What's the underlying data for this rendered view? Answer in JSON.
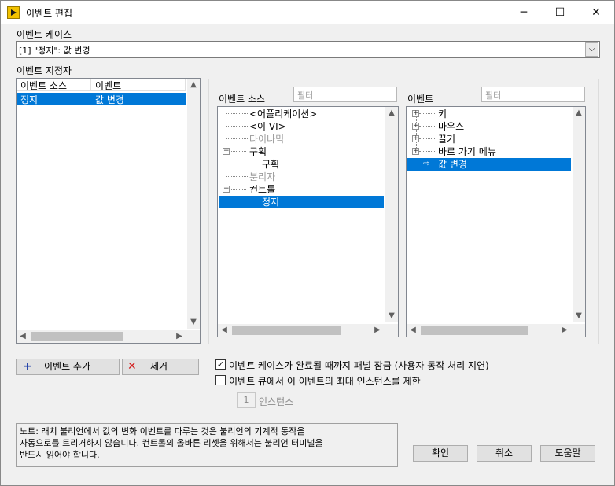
{
  "window": {
    "title": "이벤트 편집",
    "minimize_glyph": "─",
    "maximize_glyph": "☐",
    "close_glyph": "✕"
  },
  "event_cases": {
    "label": "이벤트 케이스",
    "selected": "[1] \"정지\": 값 변경",
    "dropdown_glyph": "⌵"
  },
  "specifiers": {
    "label": "이벤트 지정자",
    "columns": [
      "이벤트 소스",
      "이벤트"
    ],
    "rows": [
      {
        "source": "정지",
        "event": "값 변경"
      }
    ]
  },
  "event_sources": {
    "label": "이벤트 소스",
    "filter_placeholder": "필터",
    "items": [
      {
        "label": "<어플리케이션>",
        "disabled": false,
        "selected": false
      },
      {
        "label": "<이 VI>",
        "disabled": false,
        "selected": false
      },
      {
        "label": "다이나믹",
        "disabled": true,
        "selected": false
      },
      {
        "label": "구획",
        "disabled": false,
        "selected": false,
        "expander": "−"
      },
      {
        "label": "구획",
        "disabled": false,
        "selected": false
      },
      {
        "label": "분리자",
        "disabled": true,
        "selected": false
      },
      {
        "label": "컨트롤",
        "disabled": false,
        "selected": false,
        "expander": "−"
      },
      {
        "label": "정지",
        "disabled": false,
        "selected": true
      }
    ]
  },
  "events": {
    "label": "이벤트",
    "filter_placeholder": "필터",
    "items": [
      {
        "label": "키",
        "expander": "+",
        "selected": false
      },
      {
        "label": "마우스",
        "expander": "+",
        "selected": false
      },
      {
        "label": "끌기",
        "expander": "+",
        "selected": false
      },
      {
        "label": "바로 가기 메뉴",
        "expander": "+",
        "selected": false
      },
      {
        "label": "값 변경",
        "expander": "",
        "selected": true,
        "marker": "⇨"
      }
    ]
  },
  "buttons": {
    "add_event": "이벤트 추가",
    "add_icon": "+",
    "remove": "제거",
    "remove_icon": "✕",
    "ok": "확인",
    "cancel": "취소",
    "help": "도움말"
  },
  "options": {
    "lock_panel": {
      "label": "이벤트 케이스가 완료될 때까지 패널 잠금 (사용자 동작 처리 지연)",
      "checked": true
    },
    "limit_queue": {
      "label": "이벤트 큐에서 이 이벤트의 최대 인스턴스를 제한",
      "checked": false
    },
    "instances_value": "1",
    "instances_label": "인스턴스"
  },
  "note": {
    "line1": "노트:  래치 불리언에서 값의 변화 이벤트를 다루는 것은 불리언의 기계적 동작을",
    "line2": "자동으로를 트리거하지 않습니다. 컨트롤의 올바른 리셋을 위해서는 불리언 터미널을",
    "line3": "반드시 읽어야 합니다."
  },
  "scroll_glyphs": {
    "up": "▲",
    "down": "▼",
    "left": "◀",
    "right": "▶"
  },
  "colors": {
    "selection": "#0078d7",
    "app_icon": "#f2c200"
  }
}
